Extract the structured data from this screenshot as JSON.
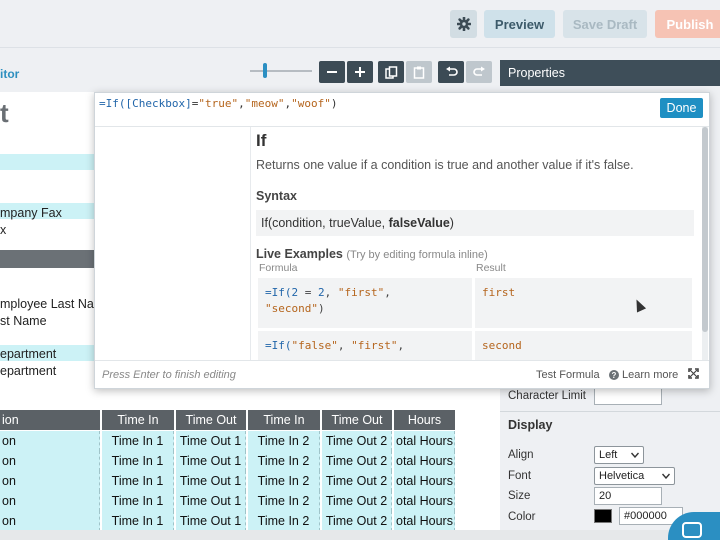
{
  "topbar": {
    "preview_label": "Preview",
    "save_draft_label": "Save Draft",
    "publish_label": "Publish"
  },
  "editor": {
    "title": "itor"
  },
  "canvas": {
    "doc_title": "t",
    "labels": [
      "mpany Fax",
      "x",
      "mployee Last Nar",
      "st Name",
      "epartment",
      "epartment"
    ],
    "grid": {
      "headers": [
        "ion",
        "Time In",
        "Time Out",
        "Time In",
        "Time Out",
        "Hours"
      ],
      "row": [
        "on",
        "Time In 1",
        "Time Out 1",
        "Time In 2",
        "Time Out 2",
        "otal Hours"
      ],
      "row_count": 5
    }
  },
  "properties": {
    "header": "Properties",
    "character_limit_label": "Character Limit",
    "display_section": "Display",
    "align_label": "Align",
    "align_value": "Left",
    "font_label": "Font",
    "font_value": "Helvetica",
    "size_label": "Size",
    "size_value": "20",
    "color_label": "Color",
    "color_value": "#000000"
  },
  "formula_popup": {
    "formula_parts": {
      "fn": "=If(",
      "ref": "[Checkbox]",
      "eq": "=",
      "s1": "\"true\"",
      "c1": ",",
      "s2": "\"meow\"",
      "c2": ",",
      "s3": "\"woof\"",
      "close": ")"
    },
    "done_label": "Done",
    "function_name": "If",
    "description": "Returns one value if a condition is true and another value if it's false.",
    "syntax_header": "Syntax",
    "syntax_text": "If(condition, trueValue, ",
    "syntax_bold": "falseValue",
    "syntax_close": ")",
    "live_examples_header": "Live Examples",
    "live_examples_hint": "(Try by editing formula inline)",
    "formula_col": "Formula",
    "result_col": "Result",
    "examples": [
      {
        "pre": "=If(",
        "a": "2",
        "op": " = ",
        "b": "2",
        "sep": ", ",
        "s1": "\"first\"",
        "c": ",",
        "s2": "\"second\"",
        "close": ")",
        "result": "first"
      },
      {
        "pre": "=If(",
        "s0": "\"false\"",
        "sep": ", ",
        "s1": "\"first\"",
        "c": ",",
        "result": "second"
      }
    ],
    "footer_hint": "Press Enter to finish editing",
    "test_formula_label": "Test Formula",
    "learn_more_label": "Learn more"
  },
  "colors": {
    "accent": "#1e8fc3",
    "dark": "#3e4e59",
    "highlight": "#ccf2f6",
    "publish": "#f6c3b4"
  },
  "icons": [
    "gear-icon",
    "zoom-out-icon",
    "zoom-in-icon",
    "copy-icon",
    "paste-icon",
    "undo-icon",
    "redo-icon",
    "help-icon",
    "expand-icon",
    "chat-icon"
  ]
}
